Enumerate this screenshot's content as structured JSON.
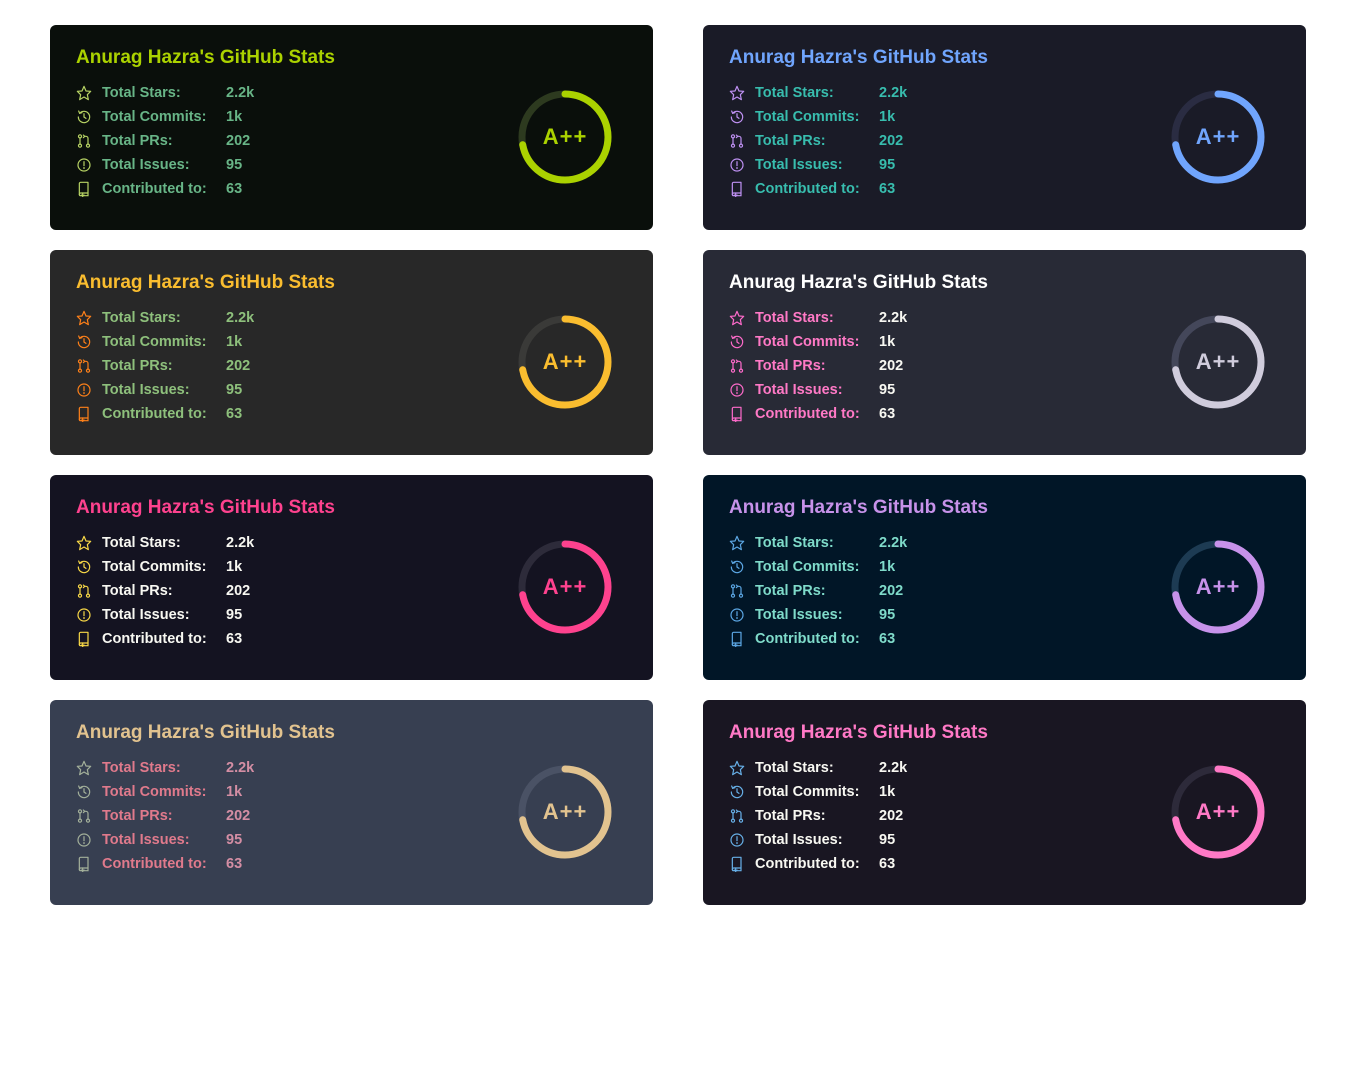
{
  "title": "Anurag Hazra's GitHub Stats",
  "rank": "A++",
  "stats": [
    {
      "icon": "star",
      "label": "Total Stars:",
      "value": "2.2k"
    },
    {
      "icon": "clock",
      "label": "Total Commits:",
      "value": "1k"
    },
    {
      "icon": "pr",
      "label": "Total PRs:",
      "value": "202"
    },
    {
      "icon": "issue",
      "label": "Total Issues:",
      "value": "95"
    },
    {
      "icon": "repo",
      "label": "Contributed to:",
      "value": "63"
    }
  ],
  "themes": [
    {
      "name": "merko",
      "bg": "#0a0f0b",
      "title": "#abd200",
      "text": "#68b587",
      "icon": "#b7d364",
      "ring": "#abd200",
      "ringBg": "#2d3a1f"
    },
    {
      "name": "tokyonight",
      "bg": "#1a1b27",
      "title": "#70a5fd",
      "text": "#38bdae",
      "icon": "#bf91f3",
      "ring": "#70a5fd",
      "ringBg": "#2a2c42"
    },
    {
      "name": "gruvbox",
      "bg": "#282828",
      "title": "#fabd2f",
      "text": "#8ec07c",
      "icon": "#fe8019",
      "ring": "#fabd2f",
      "ringBg": "#3a3a38"
    },
    {
      "name": "dracula",
      "bg": "#282a36",
      "title": "#ffffff",
      "text": "#f8f8f2",
      "icon": "#ff6bcb",
      "ring": "#d0ccdc",
      "ringBg": "#44475a",
      "labelColor": "#ff79c6"
    },
    {
      "name": "radical",
      "bg": "#141321",
      "title": "#fe428e",
      "text": "#f8f8f2",
      "icon": "#f8d847",
      "ring": "#fe428e",
      "ringBg": "#2d2b3a"
    },
    {
      "name": "nightowl",
      "bg": "#011627",
      "title": "#c792ea",
      "text": "#7fdbca",
      "icon": "#5ca7e4",
      "ring": "#c792ea",
      "ringBg": "#1d3b53"
    },
    {
      "name": "calm",
      "bg": "#373f51",
      "title": "#e2c38f",
      "text": "#d48ea4",
      "icon": "#a3b09a",
      "ring": "#e2c38f",
      "ringBg": "#4a5265",
      "labelColor": "#e07a8c"
    },
    {
      "name": "omni",
      "bg": "#191622",
      "title": "#ff79c6",
      "text": "#f8f8f2",
      "icon": "#67b0e8",
      "ring": "#ff79c6",
      "ringBg": "#2d2a3a"
    }
  ]
}
